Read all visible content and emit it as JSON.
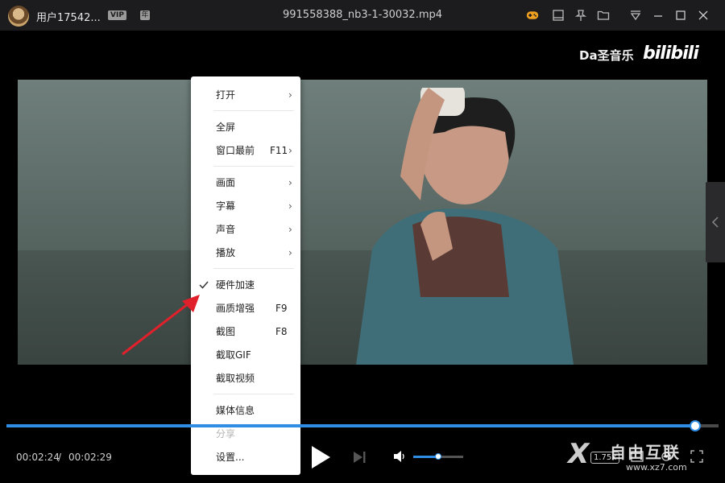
{
  "titlebar": {
    "username": "用户17542...",
    "vip_badge": "VIP",
    "level_badge": "年",
    "filename": "991558388_nb3-1-30032.mp4",
    "icons": [
      "game-icon",
      "window-icon",
      "pin-icon",
      "folder-icon",
      "dropdown-menu-icon",
      "minimize-icon",
      "maximize-icon",
      "close-icon"
    ]
  },
  "video": {
    "watermark_text": "Da圣音乐",
    "platform_logo": "bilibili"
  },
  "context_menu": {
    "items": [
      {
        "label": "打开",
        "shortcut": "",
        "submenu": true
      },
      {
        "label": "全屏",
        "shortcut": "",
        "submenu": false
      },
      {
        "label": "窗口最前",
        "shortcut": "F11",
        "submenu": true
      },
      {
        "label": "画面",
        "shortcut": "",
        "submenu": true
      },
      {
        "label": "字幕",
        "shortcut": "",
        "submenu": true
      },
      {
        "label": "声音",
        "shortcut": "",
        "submenu": true
      },
      {
        "label": "播放",
        "shortcut": "",
        "submenu": true
      },
      {
        "label": "硬件加速",
        "shortcut": "",
        "submenu": false,
        "checked": true
      },
      {
        "label": "画质增强",
        "shortcut": "F9",
        "submenu": false
      },
      {
        "label": "截图",
        "shortcut": "F8",
        "submenu": false
      },
      {
        "label": "截取GIF",
        "shortcut": "",
        "submenu": false
      },
      {
        "label": "截取视频",
        "shortcut": "",
        "submenu": false
      },
      {
        "label": "媒体信息",
        "shortcut": "",
        "submenu": false
      },
      {
        "label": "分享",
        "shortcut": "",
        "submenu": false,
        "disabled": true
      },
      {
        "label": "设置...",
        "shortcut": "",
        "submenu": false
      }
    ]
  },
  "controls": {
    "time_current": "00:02:24",
    "time_separator": "/",
    "time_total": "00:02:29",
    "progress_fraction": 0.967,
    "volume_fraction": 0.5,
    "speed": "1.75x",
    "accent_color": "#2f8de4"
  },
  "site_watermark": {
    "name": "自由互联",
    "url": "www.xz7.com"
  }
}
